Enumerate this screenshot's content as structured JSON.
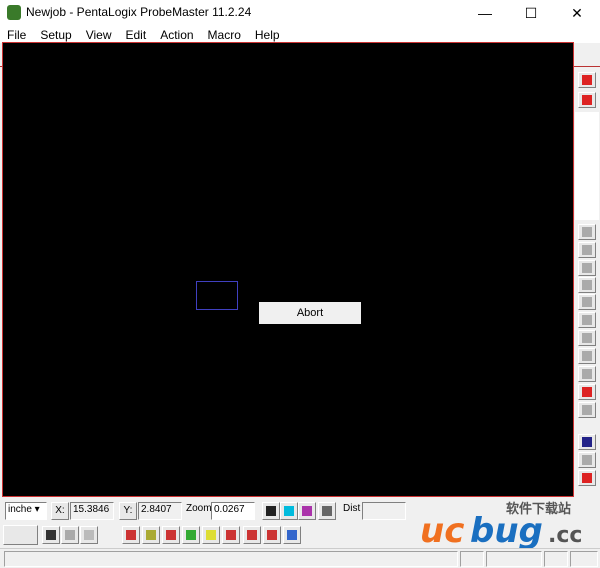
{
  "window": {
    "title": "Newjob - PentaLogix ProbeMaster 11.2.24",
    "minimize": "—",
    "maximize": "☐",
    "close": "✕"
  },
  "menu": [
    "File",
    "Setup",
    "View",
    "Edit",
    "Action",
    "Macro",
    "Help"
  ],
  "toolbar_icons": [
    "new-file-icon",
    "open-folder-icon",
    "save-icon",
    "print-icon",
    "context-help-icon",
    "probe-icon",
    "grid-points-icon",
    "align-icon",
    "select-points-icon",
    "list-points-icon",
    "offset-icon",
    "pin-icon",
    "mirror-icon",
    "question-net-icon",
    "number-net-icon",
    "net-compare-icon",
    "report-icon",
    "component-icon",
    "layers-icon",
    "route-icon",
    "undo-icon"
  ],
  "canvas": {
    "abort_label": "Abort",
    "background": "#000000",
    "selection_color": "#4040c0"
  },
  "coords": {
    "units": "inche",
    "x_label": "X:",
    "x_value": "15.3846",
    "y_label": "Y:",
    "y_value": "2.8407",
    "zoom_label": "Zoom",
    "zoom_value": "0.0267",
    "dist_label": "Dist",
    "dist_value": ""
  },
  "watermark": {
    "text": "ucbug.cc",
    "subtitle": "软件下载站"
  },
  "colors": {
    "accent_red": "#cc3333",
    "highlight_blue": "#0066cc"
  }
}
